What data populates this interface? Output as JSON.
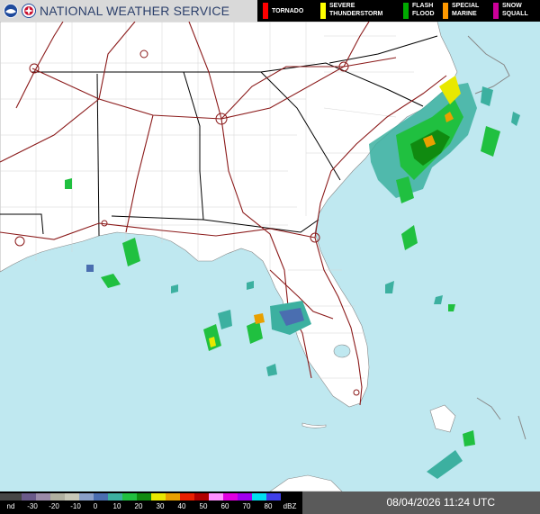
{
  "header": {
    "title": "NATIONAL WEATHER SERVICE",
    "logos": [
      "noaa-logo",
      "nws-logo"
    ]
  },
  "legend": {
    "items": [
      {
        "label": "TORNADO",
        "color": "#ff0000"
      },
      {
        "label": "SEVERE\nTHUNDERSTORM",
        "color": "#ffff00"
      },
      {
        "label": "FLASH\nFLOOD",
        "color": "#00aa00"
      },
      {
        "label": "SPECIAL\nMARINE",
        "color": "#ff9900"
      },
      {
        "label": "SNOW\nSQUALL",
        "color": "#cc0099"
      }
    ]
  },
  "map": {
    "region": "Southeastern United States",
    "land_color": "#ffffff",
    "water_color": "#bfe8f0",
    "state_border_color": "#000000",
    "county_border_color": "#cccccc",
    "highway_color": "#8b1a1a"
  },
  "dbz_scale": {
    "labels": [
      "nd",
      "-30",
      "-20",
      "-10",
      "0",
      "10",
      "20",
      "30",
      "40",
      "50",
      "60",
      "70",
      "80",
      "dBZ"
    ],
    "colors": [
      "#464646",
      "#6a5a8a",
      "#9a8aa8",
      "#b0b0a0",
      "#c8c8b8",
      "#8aa0c8",
      "#4a6eb0",
      "#3cb0a0",
      "#20c040",
      "#108a10",
      "#e8e800",
      "#e8a000",
      "#e82000",
      "#b00000",
      "#ff90ff",
      "#e000e0",
      "#a000f0",
      "#00e0f0",
      "#4040e8"
    ]
  },
  "timestamp": "08/04/2026 11:24 UTC"
}
